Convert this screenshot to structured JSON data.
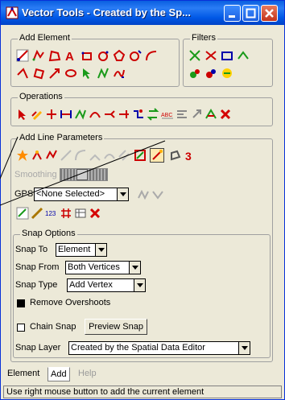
{
  "window": {
    "title": "Vector Tools - Created by the Sp..."
  },
  "groups": {
    "add_element": "Add Element",
    "filters": "Filters",
    "operations": "Operations",
    "add_line_parameters": "Add Line Parameters",
    "snap_options": "Snap Options"
  },
  "line_params": {
    "smoothing_label": "Smoothing",
    "gps_label": "GPS",
    "gps_value": "<None Selected>"
  },
  "snap": {
    "snap_to_label": "Snap To",
    "snap_to_value": "Element",
    "snap_from_label": "Snap From",
    "snap_from_value": "Both Vertices",
    "snap_type_label": "Snap Type",
    "snap_type_value": "Add Vertex",
    "remove_overshoots_label": "Remove Overshoots",
    "remove_overshoots_checked": true,
    "chain_snap_label": "Chain Snap",
    "chain_snap_checked": false,
    "preview_snap_label": "Preview Snap",
    "snap_layer_label": "Snap Layer",
    "snap_layer_value": "Created by the Spatial Data Editor"
  },
  "tabs": {
    "element": "Element",
    "add": "Add",
    "help": "Help"
  },
  "status": "Use right mouse button to add the current element",
  "colors": {
    "title_bar": "#0058e6",
    "panel": "#ece9d8",
    "accent_red": "#d40000",
    "accent_green": "#1a9a1a"
  }
}
